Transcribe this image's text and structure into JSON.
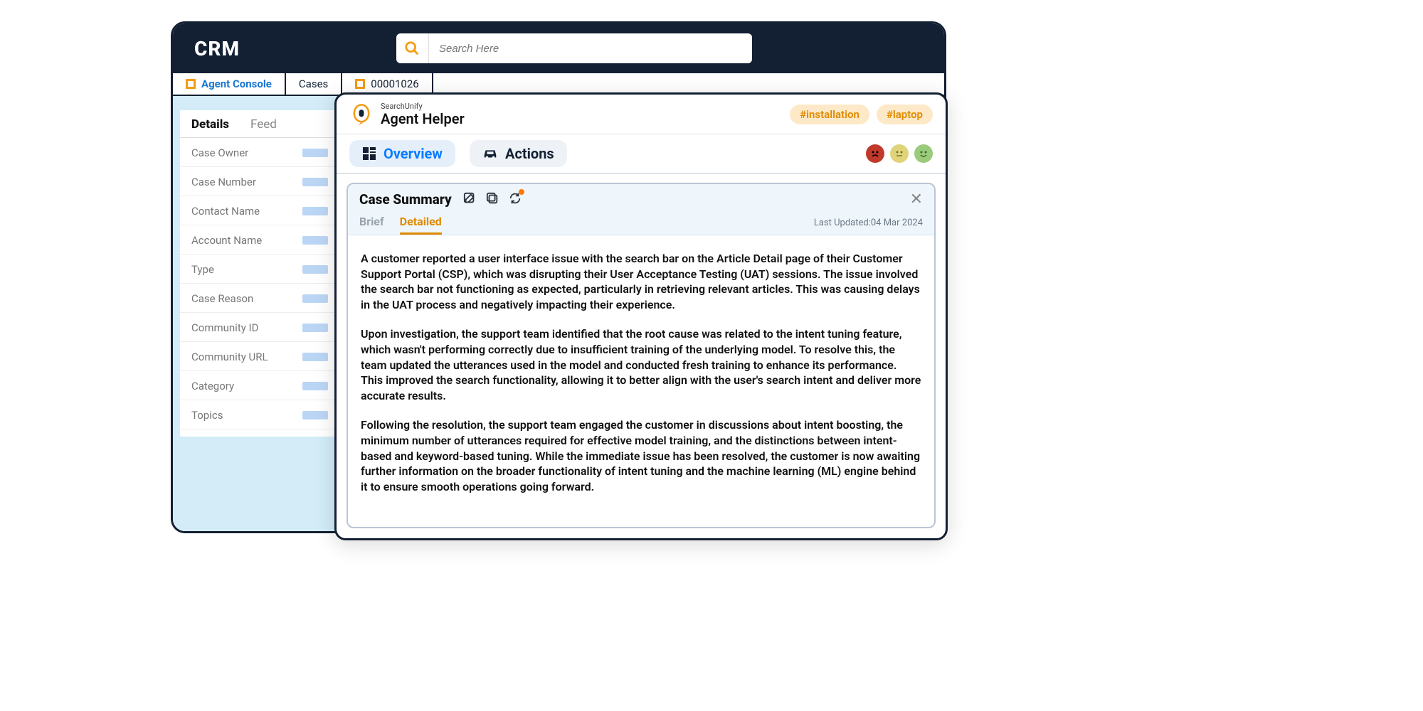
{
  "app": {
    "title": "CRM"
  },
  "search": {
    "placeholder": "Search Here"
  },
  "tabbar": {
    "tabs": [
      {
        "label": "Agent Console"
      },
      {
        "label": "Cases"
      },
      {
        "label": "00001026"
      }
    ]
  },
  "sidebar": {
    "tabs": {
      "details": "Details",
      "feed": "Feed"
    },
    "rows": [
      "Case Owner",
      "Case Number",
      "Contact Name",
      "Account Name",
      "Type",
      "Case Reason",
      "Community ID",
      "Community URL",
      "Category",
      "Topics"
    ]
  },
  "helper": {
    "brand": "SearchUnify",
    "title": "Agent Helper",
    "tags": [
      "#installation",
      "#laptop"
    ],
    "tabs": {
      "overview": "Overview",
      "actions": "Actions"
    },
    "sentiments": [
      "sad",
      "neutral",
      "happy"
    ]
  },
  "summary": {
    "title": "Case Summary",
    "subtabs": {
      "brief": "Brief",
      "detailed": "Detailed"
    },
    "lastUpdatedLabel": "Last Updated:",
    "lastUpdated": "04 Mar 2024",
    "paragraphs": [
      "A customer reported a user interface issue with the search bar on the Article Detail page of their Customer Support Portal (CSP), which was disrupting their User Acceptance Testing (UAT) sessions. The issue involved the search bar not functioning as expected, particularly in retrieving relevant articles. This was causing delays in the UAT process and negatively impacting their experience.",
      "Upon investigation, the support team identified that the root cause was related to the intent tuning feature, which wasn't performing correctly due to insufficient training of the underlying model. To resolve this, the team updated the utterances used in the model and conducted fresh training to enhance its performance. This improved the search functionality, allowing it to better align with the user's search intent and deliver more accurate results.",
      "Following the resolution, the support team engaged the customer in discussions about intent boosting, the minimum number of utterances required for effective model training, and the distinctions between intent-based and keyword-based tuning. While the immediate issue has been resolved, the customer is now awaiting further information on the broader functionality of intent tuning and the machine learning (ML) engine behind it to ensure smooth operations going forward."
    ]
  }
}
